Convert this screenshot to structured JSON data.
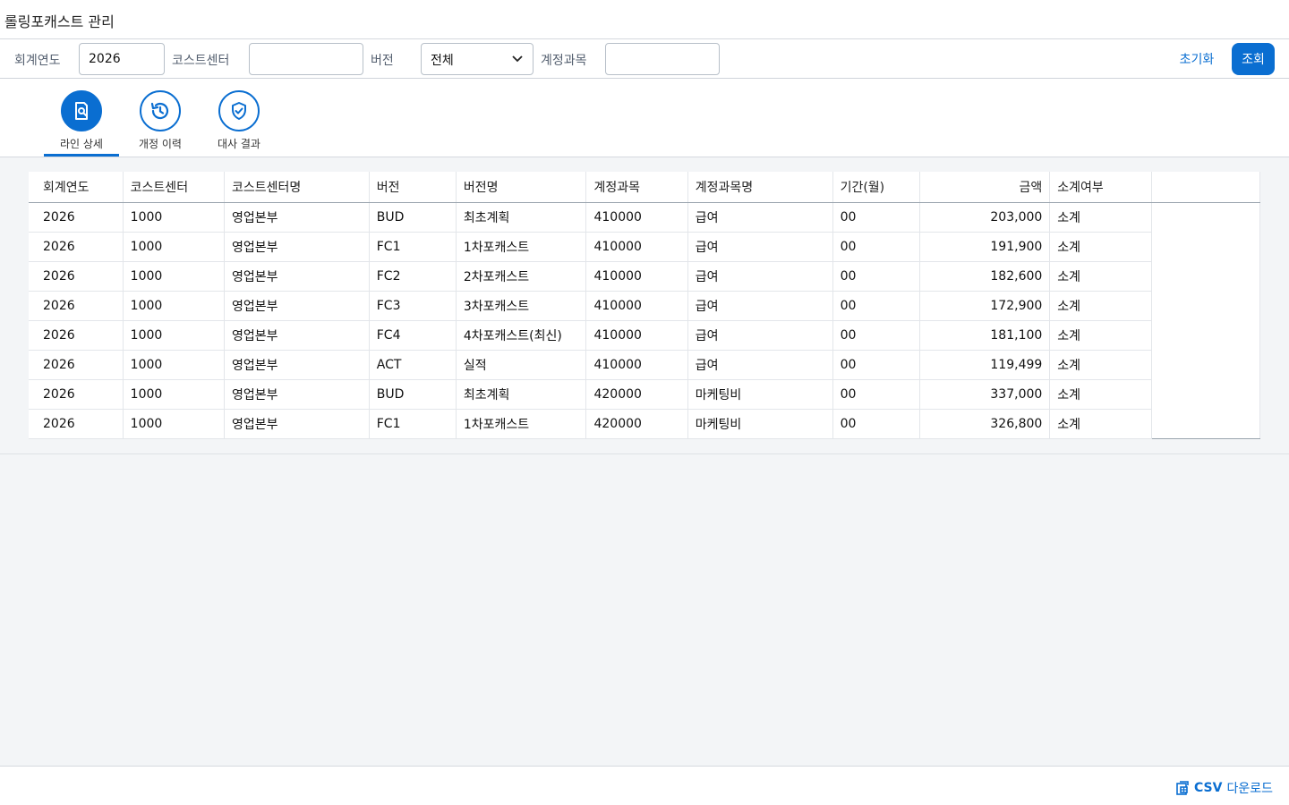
{
  "app": {
    "title": "롤링포캐스트 관리"
  },
  "filters": {
    "fiscal_year_label": "회계연도",
    "fiscal_year_value": "2026",
    "cost_center_label": "코스트센터",
    "cost_center_value": "",
    "version_label": "버전",
    "version_value": "전체",
    "account_label": "계정과목",
    "account_value": "",
    "reset_label": "초기화",
    "search_label": "조회"
  },
  "tabs": [
    {
      "label": "라인 상세",
      "icon": "document-search-icon",
      "active": true
    },
    {
      "label": "개정 이력",
      "icon": "history-icon",
      "active": false
    },
    {
      "label": "대사 결과",
      "icon": "shield-check-icon",
      "active": false
    }
  ],
  "table": {
    "columns": [
      "회계연도",
      "코스트센터",
      "코스트센터명",
      "버전",
      "버전명",
      "계정과목",
      "계정과목명",
      "기간(월)",
      "금액",
      "소계여부"
    ],
    "rows": [
      [
        "2026",
        "1000",
        "영업본부",
        "BUD",
        "최초계획",
        "410000",
        "급여",
        "00",
        "203,000",
        "소계"
      ],
      [
        "2026",
        "1000",
        "영업본부",
        "FC1",
        "1차포캐스트",
        "410000",
        "급여",
        "00",
        "191,900",
        "소계"
      ],
      [
        "2026",
        "1000",
        "영업본부",
        "FC2",
        "2차포캐스트",
        "410000",
        "급여",
        "00",
        "182,600",
        "소계"
      ],
      [
        "2026",
        "1000",
        "영업본부",
        "FC3",
        "3차포캐스트",
        "410000",
        "급여",
        "00",
        "172,900",
        "소계"
      ],
      [
        "2026",
        "1000",
        "영업본부",
        "FC4",
        "4차포캐스트(최신)",
        "410000",
        "급여",
        "00",
        "181,100",
        "소계"
      ],
      [
        "2026",
        "1000",
        "영업본부",
        "ACT",
        "실적",
        "410000",
        "급여",
        "00",
        "119,499",
        "소계"
      ],
      [
        "2026",
        "1000",
        "영업본부",
        "BUD",
        "최초계획",
        "420000",
        "마케팅비",
        "00",
        "337,000",
        "소계"
      ],
      [
        "2026",
        "1000",
        "영업본부",
        "FC1",
        "1차포캐스트",
        "420000",
        "마케팅비",
        "00",
        "326,800",
        "소계"
      ]
    ]
  },
  "footer": {
    "csv_bold": "CSV",
    "csv_rest": "다운로드",
    "icon": "export-icon"
  },
  "colors": {
    "accent": "#0a6ed1"
  }
}
